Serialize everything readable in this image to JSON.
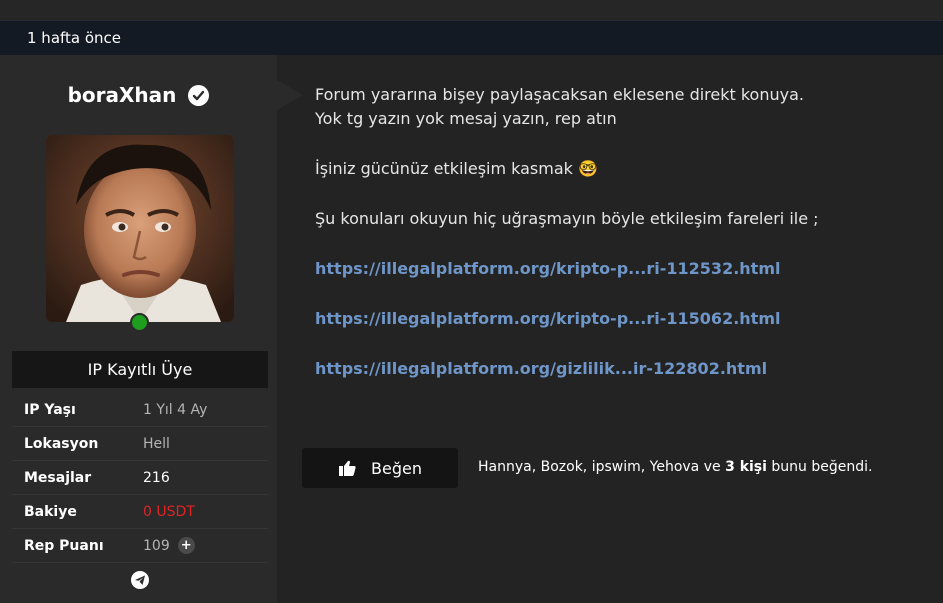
{
  "post": {
    "time": "1 hafta önce"
  },
  "user": {
    "name": "boraXhan",
    "rank": "IP Kayıtlı Üye",
    "stats": {
      "ip_age_label": "IP Yaşı",
      "ip_age_value": "1 Yıl 4 Ay",
      "location_label": "Lokasyon",
      "location_value": "Hell",
      "messages_label": "Mesajlar",
      "messages_value": "216",
      "balance_label": "Bakiye",
      "balance_value": "0 USDT",
      "rep_label": "Rep Puanı",
      "rep_value": "109",
      "rep_plus": "+"
    },
    "online_color": "#1f9d1f",
    "verified_icon": "check-circle-icon",
    "contact_icon": "telegram-icon"
  },
  "message": {
    "line1": "Forum yararına bişey paylaşacaksan eklesene direkt konuya.",
    "line2": "Yok tg yazın yok mesaj yazın, rep atın",
    "line3": "İşiniz gücünüz etkileşim kasmak",
    "line3_emoji": "🤓",
    "line4": "Şu konuları okuyun hiç uğraşmayın böyle etkileşim fareleri ile ;",
    "links": [
      "https://illegalplatform.org/kripto-p...ri-112532.html",
      "https://illegalplatform.org/kripto-p...ri-115062.html",
      "https://illegalplatform.org/gizlilik...ir-122802.html"
    ],
    "link_color": "#6f96c8"
  },
  "reactions": {
    "like_label": "Beğen",
    "likers_prefix": "Hannya,  Bozok,  ipswim,  Yehova ve ",
    "likers_count": "3 kişi",
    "likers_suffix": " bunu beğendi."
  }
}
